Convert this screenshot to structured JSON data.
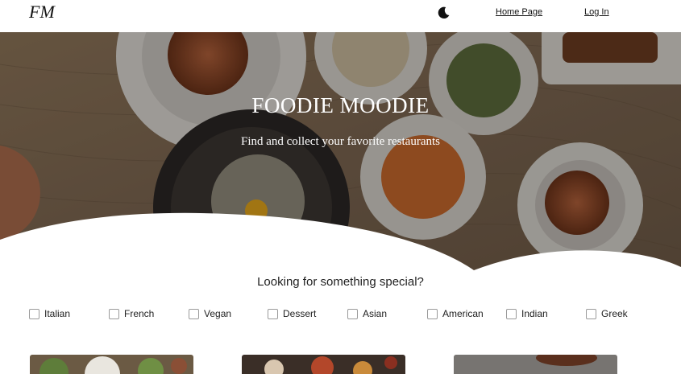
{
  "header": {
    "logo": "FM",
    "theme_icon": "moon-icon",
    "nav": [
      {
        "label": "Home Page"
      },
      {
        "label": "Log In"
      }
    ]
  },
  "hero": {
    "title": "FOODIE MOODIE",
    "subtitle": "Find and collect your favorite restaurants"
  },
  "filters": {
    "heading": "Looking for something special?",
    "options": [
      {
        "label": "Italian",
        "checked": false
      },
      {
        "label": "French",
        "checked": false
      },
      {
        "label": "Vegan",
        "checked": false
      },
      {
        "label": "Dessert",
        "checked": false
      },
      {
        "label": "Asian",
        "checked": false
      },
      {
        "label": "American",
        "checked": false
      },
      {
        "label": "Indian",
        "checked": false
      },
      {
        "label": "Greek",
        "checked": false
      }
    ]
  },
  "cards": [
    {
      "image": "salad-image"
    },
    {
      "image": "grill-image"
    },
    {
      "image": "bowl-image"
    }
  ]
}
